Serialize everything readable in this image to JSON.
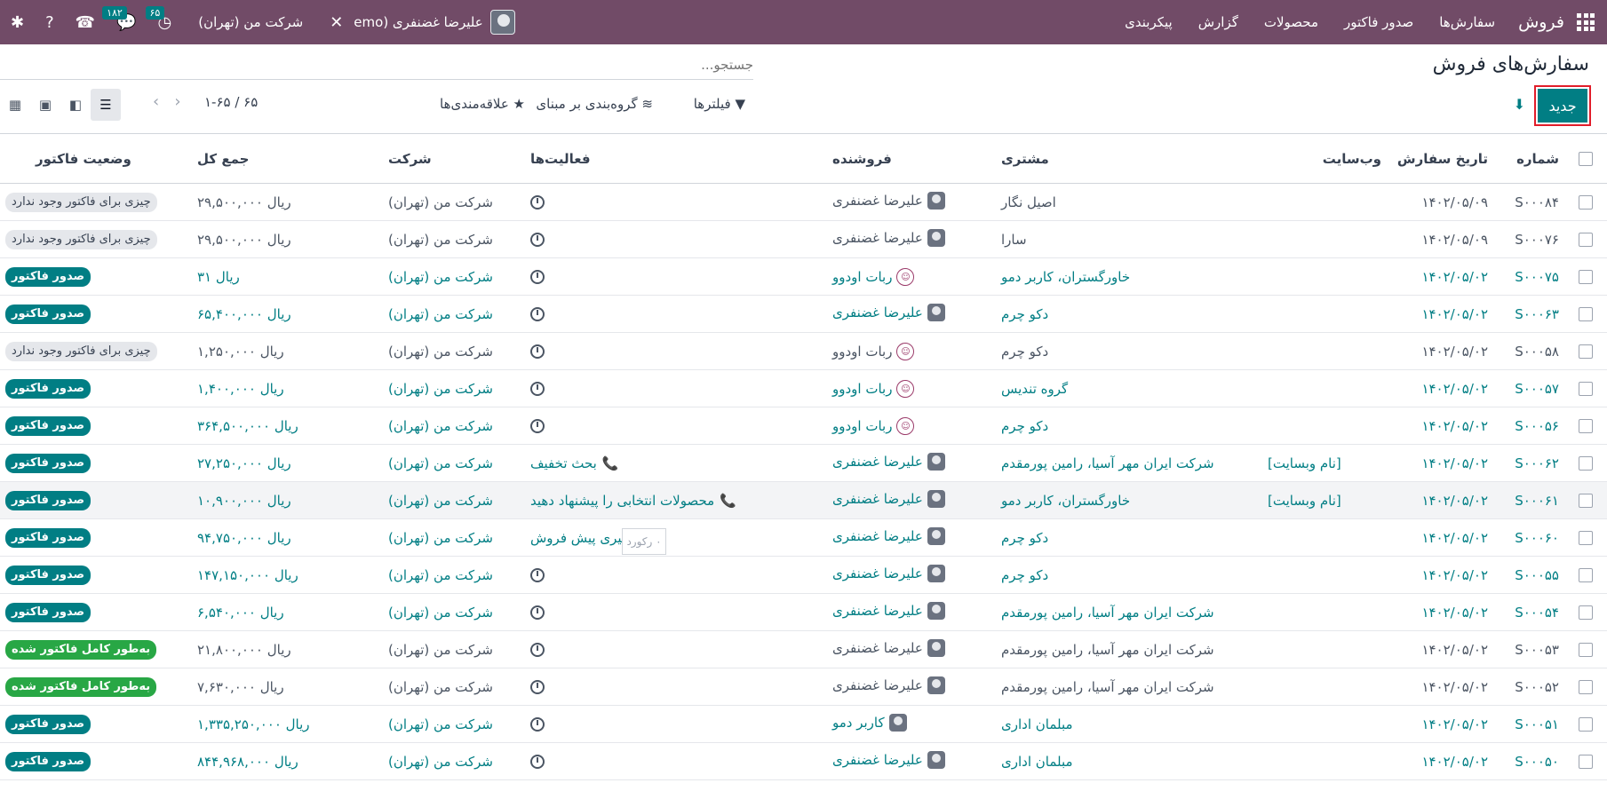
{
  "navbar": {
    "app_name": "فروش",
    "menu": [
      "سفارش‌ها",
      "صدور فاکتور",
      "محصولات",
      "گزارش",
      "پیکربندی"
    ],
    "company": "شرکت من (تهران)",
    "activity_count": "۶۵",
    "messages_count": "۱۸۲",
    "user_name": "علیرضا غضنفری (emo"
  },
  "page": {
    "title": "سفارش‌های فروش",
    "search_placeholder": "جستجو...",
    "new_button": "جدید",
    "filters": "فیلترها",
    "group_by": "گروه‌بندی بر مبنای",
    "favorites": "علاقه‌مندی‌ها",
    "pager": "۱-۶۵ / ۶۵"
  },
  "columns": {
    "number": "شماره",
    "date": "تاریخ سفارش",
    "website": "وب‌سایت",
    "customer": "مشتری",
    "salesperson": "فروشنده",
    "activities": "فعالیت‌ها",
    "company": "شرکت",
    "total": "جمع کل",
    "invoice_status": "وضعیت فاکتور"
  },
  "tooltip": "۰ رکورد",
  "rows": [
    {
      "number": "S۰۰۰۸۴",
      "date": "۱۴۰۲/۰۵/۰۹",
      "website": "",
      "customer": "اصیل نگار",
      "salesperson": "علیرضا غضنفری",
      "sp_type": "user",
      "activity": "",
      "activity_type": "clock",
      "company": "شرکت من (تهران)",
      "total": "ریال ۲۹,۵۰۰,۰۰۰",
      "invoice": "چیزی برای فاکتور وجود ندارد",
      "inv_type": "none",
      "teal": false
    },
    {
      "number": "S۰۰۰۷۶",
      "date": "۱۴۰۲/۰۵/۰۹",
      "website": "",
      "customer": "سارا",
      "salesperson": "علیرضا غضنفری",
      "sp_type": "user",
      "activity": "",
      "activity_type": "clock",
      "company": "شرکت من (تهران)",
      "total": "ریال ۲۹,۵۰۰,۰۰۰",
      "invoice": "چیزی برای فاکتور وجود ندارد",
      "inv_type": "none",
      "teal": false
    },
    {
      "number": "S۰۰۰۷۵",
      "date": "۱۴۰۲/۰۵/۰۲",
      "website": "",
      "customer": "خاورگستران، کاربر دمو",
      "salesperson": "ربات اودوو",
      "sp_type": "bot",
      "activity": "",
      "activity_type": "clock",
      "company": "شرکت من (تهران)",
      "total": "ریال ۳۱",
      "invoice": "صدور فاکتور",
      "inv_type": "to",
      "teal": true
    },
    {
      "number": "S۰۰۰۶۳",
      "date": "۱۴۰۲/۰۵/۰۲",
      "website": "",
      "customer": "دکو چرم",
      "salesperson": "علیرضا غضنفری",
      "sp_type": "user",
      "activity": "",
      "activity_type": "clock",
      "company": "شرکت من (تهران)",
      "total": "ریال ۶۵,۴۰۰,۰۰۰",
      "invoice": "صدور فاکتور",
      "inv_type": "to",
      "teal": true
    },
    {
      "number": "S۰۰۰۵۸",
      "date": "۱۴۰۲/۰۵/۰۲",
      "website": "",
      "customer": "دکو چرم",
      "salesperson": "ربات اودوو",
      "sp_type": "bot",
      "activity": "",
      "activity_type": "clock",
      "company": "شرکت من (تهران)",
      "total": "ریال ۱,۲۵۰,۰۰۰",
      "invoice": "چیزی برای فاکتور وجود ندارد",
      "inv_type": "none",
      "teal": false
    },
    {
      "number": "S۰۰۰۵۷",
      "date": "۱۴۰۲/۰۵/۰۲",
      "website": "",
      "customer": "گروه تندیس",
      "salesperson": "ربات اودوو",
      "sp_type": "bot",
      "activity": "",
      "activity_type": "clock",
      "company": "شرکت من (تهران)",
      "total": "ریال ۱,۴۰۰,۰۰۰",
      "invoice": "صدور فاکتور",
      "inv_type": "to",
      "teal": true
    },
    {
      "number": "S۰۰۰۵۶",
      "date": "۱۴۰۲/۰۵/۰۲",
      "website": "",
      "customer": "دکو چرم",
      "salesperson": "ربات اودوو",
      "sp_type": "bot",
      "activity": "",
      "activity_type": "clock",
      "company": "شرکت من (تهران)",
      "total": "ریال ۳۶۴,۵۰۰,۰۰۰",
      "invoice": "صدور فاکتور",
      "inv_type": "to",
      "teal": true
    },
    {
      "number": "S۰۰۰۶۲",
      "date": "۱۴۰۲/۰۵/۰۲",
      "website": "[نام وبسایت]",
      "customer": "شرکت ایران مهر آسیا، رامین پورمقدم",
      "salesperson": "علیرضا غضنفری",
      "sp_type": "user",
      "activity": "بحث تخفیف",
      "activity_type": "phone",
      "company": "شرکت من (تهران)",
      "total": "ریال ۲۷,۲۵۰,۰۰۰",
      "invoice": "صدور فاکتور",
      "inv_type": "to",
      "teal": true
    },
    {
      "number": "S۰۰۰۶۱",
      "date": "۱۴۰۲/۰۵/۰۲",
      "website": "[نام وبسایت]",
      "customer": "خاورگستران، کاربر دمو",
      "salesperson": "علیرضا غضنفری",
      "sp_type": "user",
      "activity": "محصولات انتخابی را پیشنهاد دهید",
      "activity_type": "phone",
      "company": "شرکت من (تهران)",
      "total": "ریال ۱۰,۹۰۰,۰۰۰",
      "invoice": "صدور فاکتور",
      "inv_type": "to",
      "teal": true,
      "highlight": true
    },
    {
      "number": "S۰۰۰۶۰",
      "date": "۱۴۰۲/۰۵/۰۲",
      "website": "",
      "customer": "دکو چرم",
      "salesperson": "علیرضا غضنفری",
      "sp_type": "user",
      "activity": "پیگیری پیش فروش",
      "activity_type": "chart",
      "company": "شرکت من (تهران)",
      "total": "ریال ۹۴,۷۵۰,۰۰۰",
      "invoice": "صدور فاکتور",
      "inv_type": "to",
      "teal": true
    },
    {
      "number": "S۰۰۰۵۵",
      "date": "۱۴۰۲/۰۵/۰۲",
      "website": "",
      "customer": "دکو چرم",
      "salesperson": "علیرضا غضنفری",
      "sp_type": "user",
      "activity": "",
      "activity_type": "clock",
      "company": "شرکت من (تهران)",
      "total": "ریال ۱۴۷,۱۵۰,۰۰۰",
      "invoice": "صدور فاکتور",
      "inv_type": "to",
      "teal": true
    },
    {
      "number": "S۰۰۰۵۴",
      "date": "۱۴۰۲/۰۵/۰۲",
      "website": "",
      "customer": "شرکت ایران مهر آسیا، رامین پورمقدم",
      "salesperson": "علیرضا غضنفری",
      "sp_type": "user",
      "activity": "",
      "activity_type": "clock",
      "company": "شرکت من (تهران)",
      "total": "ریال ۶,۵۴۰,۰۰۰",
      "invoice": "صدور فاکتور",
      "inv_type": "to",
      "teal": true
    },
    {
      "number": "S۰۰۰۵۳",
      "date": "۱۴۰۲/۰۵/۰۲",
      "website": "",
      "customer": "شرکت ایران مهر آسیا، رامین پورمقدم",
      "salesperson": "علیرضا غضنفری",
      "sp_type": "user",
      "activity": "",
      "activity_type": "clock",
      "company": "شرکت من (تهران)",
      "total": "ریال ۲۱,۸۰۰,۰۰۰",
      "invoice": "به‌طور کامل فاکتور شده",
      "inv_type": "full",
      "teal": false
    },
    {
      "number": "S۰۰۰۵۲",
      "date": "۱۴۰۲/۰۵/۰۲",
      "website": "",
      "customer": "شرکت ایران مهر آسیا، رامین پورمقدم",
      "salesperson": "علیرضا غضنفری",
      "sp_type": "user",
      "activity": "",
      "activity_type": "clock",
      "company": "شرکت من (تهران)",
      "total": "ریال ۷,۶۳۰,۰۰۰",
      "invoice": "به‌طور کامل فاکتور شده",
      "inv_type": "full",
      "teal": false
    },
    {
      "number": "S۰۰۰۵۱",
      "date": "۱۴۰۲/۰۵/۰۲",
      "website": "",
      "customer": "مبلمان اداری",
      "salesperson": "کاربر دمو",
      "sp_type": "user",
      "activity": "",
      "activity_type": "clock",
      "company": "شرکت من (تهران)",
      "total": "ریال ۱,۳۳۵,۲۵۰,۰۰۰",
      "invoice": "صدور فاکتور",
      "inv_type": "to",
      "teal": true
    },
    {
      "number": "S۰۰۰۵۰",
      "date": "۱۴۰۲/۰۵/۰۲",
      "website": "",
      "customer": "مبلمان اداری",
      "salesperson": "علیرضا غضنفری",
      "sp_type": "user",
      "activity": "",
      "activity_type": "clock",
      "company": "شرکت من (تهران)",
      "total": "ریال ۸۴۴,۹۶۸,۰۰۰",
      "invoice": "صدور فاکتور",
      "inv_type": "to",
      "teal": true
    }
  ]
}
